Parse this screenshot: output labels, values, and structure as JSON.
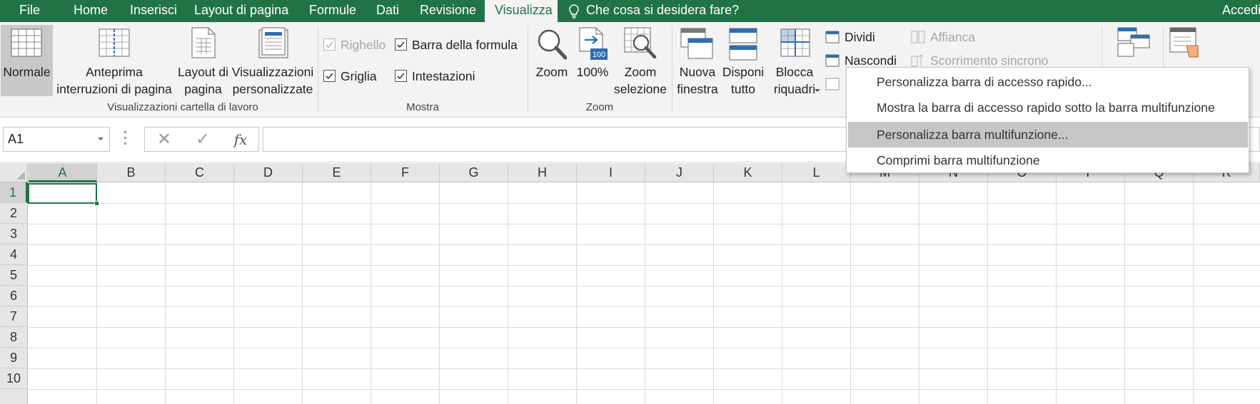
{
  "tabs": [
    {
      "label": "File"
    },
    {
      "label": "Home"
    },
    {
      "label": "Inserisci"
    },
    {
      "label": "Layout di pagina"
    },
    {
      "label": "Formule"
    },
    {
      "label": "Dati"
    },
    {
      "label": "Revisione"
    },
    {
      "label": "Visualizza"
    }
  ],
  "active_tab": "Visualizza",
  "tell_me": "Che cosa si desidera fare?",
  "sign_in": "Accedi",
  "ribbon": {
    "views": {
      "normal": "Normale",
      "page_break_1": "Anteprima",
      "page_break_2": "interruzioni di pagina",
      "page_layout_1": "Layout di",
      "page_layout_2": "pagina",
      "custom_views_1": "Visualizzazioni",
      "custom_views_2": "personalizzate",
      "group_label": "Visualizzazioni cartella di lavoro"
    },
    "show": {
      "ruler": "Righello",
      "formula_bar": "Barra della formula",
      "gridlines": "Griglia",
      "headings": "Intestazioni",
      "group_label": "Mostra"
    },
    "zoom": {
      "zoom": "Zoom",
      "zoom100": "100%",
      "zoom100_badge": "100",
      "zoom_sel_1": "Zoom",
      "zoom_sel_2": "selezione",
      "group_label": "Zoom"
    },
    "window": {
      "new_window_1": "Nuova",
      "new_window_2": "finestra",
      "arrange_1": "Disponi",
      "arrange_2": "tutto",
      "freeze_1": "Blocca",
      "freeze_2": "riquadri",
      "split": "Dividi",
      "hide": "Nascondi",
      "side_by_side": "Affianca",
      "sync_scroll": "Scorrimento sincrono"
    }
  },
  "formula_bar": {
    "name_box": "A1",
    "cancel_glyph": "✕",
    "enter_glyph": "✓",
    "fx_glyph": "fx",
    "formula": ""
  },
  "columns": [
    "A",
    "B",
    "C",
    "D",
    "E",
    "F",
    "G",
    "H",
    "I",
    "J",
    "K",
    "L",
    "M",
    "N",
    "O",
    "P",
    "Q",
    "R"
  ],
  "rows": [
    "1",
    "2",
    "3",
    "4",
    "5",
    "6",
    "7",
    "8",
    "9",
    "10"
  ],
  "active_cell": "A1",
  "context_menu": [
    {
      "label": "Personalizza barra di accesso rapido..."
    },
    {
      "label": "Mostra la barra di accesso rapido sotto la barra multifunzione"
    },
    {
      "label": "Personalizza barra multifunzione...",
      "highlighted": true
    },
    {
      "label": "Comprimi barra multifunzione"
    }
  ],
  "colors": {
    "accent": "#217346",
    "ribbon_bg": "#f3f3f3",
    "menu_highlight": "#c6c6c6",
    "blue_icon": "#2e6db4"
  }
}
